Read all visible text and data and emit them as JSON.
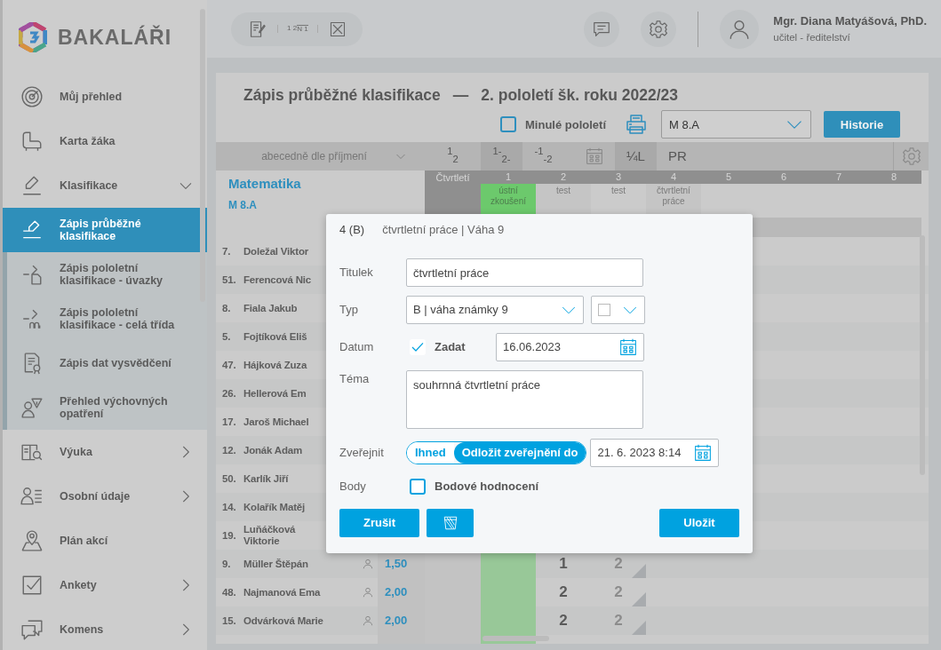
{
  "logo": {
    "text": "BAKALÁŘI"
  },
  "sidebar": {
    "items": [
      {
        "label": "Můj přehled"
      },
      {
        "label": "Karta žáka"
      },
      {
        "label": "Klasifikace",
        "expanded": true,
        "children": [
          {
            "label": "Zápis průběžné klasifikace",
            "selected": true
          },
          {
            "label": "Zápis pololetní klasifikace - úvazky",
            "selected": false
          },
          {
            "label": "Zápis pololetní klasifikace - celá třída",
            "selected": false
          },
          {
            "label": "Zápis dat vysvědčení",
            "selected": false
          },
          {
            "label": "Přehled výchovných opatření",
            "selected": false
          }
        ]
      },
      {
        "label": "Výuka",
        "expanded": false
      },
      {
        "label": "Osobní údaje",
        "expanded": false
      },
      {
        "label": "Plán akcí"
      },
      {
        "label": "Ankety",
        "expanded": false
      },
      {
        "label": "Komens",
        "expanded": false
      }
    ]
  },
  "toolbar": {
    "fraction_top": "1 2",
    "fraction_bottom": "N 1"
  },
  "user": {
    "name": "Mgr. Diana Matyášová, PhD.",
    "role": "učitel - ředitelství"
  },
  "page": {
    "title": "Zápis průběžné klasifikace",
    "separator": "—",
    "period": "2. pololetí šk. roku 2022/23",
    "previous_term": {
      "label": "Minulé pololetí",
      "checked": false
    },
    "class_select": {
      "value": "M 8.A"
    },
    "history_button": "Historie"
  },
  "view_bar": {
    "sort": "abecedně dle příjmení",
    "modes": [
      {
        "kind": "text",
        "label": "$^{1}$ $_{2}$",
        "selected": false
      },
      {
        "kind": "text",
        "label": "$^{1-}$$_{2-}$",
        "selected": true
      },
      {
        "kind": "text",
        "label": "$^{-1}$$_{-2}$",
        "selected": false
      },
      {
        "kind": "calendar",
        "selected": false
      },
      {
        "kind": "text",
        "label": "¼L",
        "selected": true
      },
      {
        "kind": "text",
        "label": "PR",
        "selected": false
      }
    ]
  },
  "table": {
    "subject": "Matematika",
    "class": "M 8.A",
    "quarter_header": "Čtvrtletí",
    "columns": [
      {
        "number": "1",
        "label": "ústní zkoušení",
        "highlighted": true
      },
      {
        "number": "2",
        "label": "test",
        "highlighted": false
      },
      {
        "number": "3",
        "label": "test",
        "highlighted": false
      },
      {
        "number": "4",
        "label": "čtvrtletní práce",
        "highlighted": false
      },
      {
        "number": "5",
        "highlighted": false
      },
      {
        "number": "6",
        "highlighted": false
      },
      {
        "number": "7",
        "highlighted": false
      },
      {
        "number": "8",
        "highlighted": false
      }
    ],
    "rows": [
      {
        "number": "7.",
        "name": "Doležal Viktor"
      },
      {
        "number": "51.",
        "name": "Ferencová Nic"
      },
      {
        "number": "8.",
        "name": "Fiala Jakub"
      },
      {
        "number": "5.",
        "name": "Fojtíková Eliš"
      },
      {
        "number": "47.",
        "name": "Hájková Zuza"
      },
      {
        "number": "26.",
        "name": "Hellerová Em"
      },
      {
        "number": "17.",
        "name": "Jaroš Michael"
      },
      {
        "number": "12.",
        "name": "Jonák Adam"
      },
      {
        "number": "50.",
        "name": "Karlík Jiří"
      },
      {
        "number": "14.",
        "name": "Kolařík Matěj"
      },
      {
        "number": "19.",
        "name": "Luňáčková Viktorie"
      },
      {
        "number": "9.",
        "name": "Müller Štěpán",
        "average": "1,50",
        "grades": {
          "2": {
            "value": "1",
            "kind": "plain"
          },
          "3": {
            "value": "2",
            "kind": "flagged"
          }
        }
      },
      {
        "number": "48.",
        "name": "Najmanová Ema",
        "average": "2,00",
        "grades": {
          "2": {
            "value": "2",
            "kind": "plain"
          },
          "3": {
            "value": "2",
            "kind": "flagged"
          }
        }
      },
      {
        "number": "15.",
        "name": "Odvárková Marie",
        "average": "2,00",
        "grades": {
          "2": {
            "value": "2",
            "kind": "plain"
          },
          "3": {
            "value": "2",
            "kind": "flagged"
          }
        }
      }
    ]
  },
  "dialog": {
    "grade": "4 (B)",
    "caption": "čtvrtletní práce | Váha 9",
    "title": {
      "label": "Titulek",
      "value": "čtvrtletní práce"
    },
    "type": {
      "label": "Typ",
      "value": "B | váha známky 9"
    },
    "date": {
      "label": "Datum",
      "toggle_label": "Zadat",
      "checked": true,
      "value": "16.06.2023"
    },
    "topic": {
      "label": "Téma",
      "value": "souhrnná čtvrtletní práce"
    },
    "publish": {
      "label": "Zveřejnit",
      "options": [
        {
          "label": "Ihned",
          "selected": false
        },
        {
          "label": "Odložit zveřejnění do",
          "selected": true
        }
      ],
      "value": "21. 6. 2023 8:14"
    },
    "points": {
      "label": "Body",
      "toggle_label": "Bodové hodnocení",
      "checked": false
    },
    "buttons": [
      {
        "kind": "text",
        "label": "Zrušit"
      },
      {
        "kind": "delete"
      },
      {
        "kind": "text",
        "label": "Uložit"
      }
    ]
  }
}
